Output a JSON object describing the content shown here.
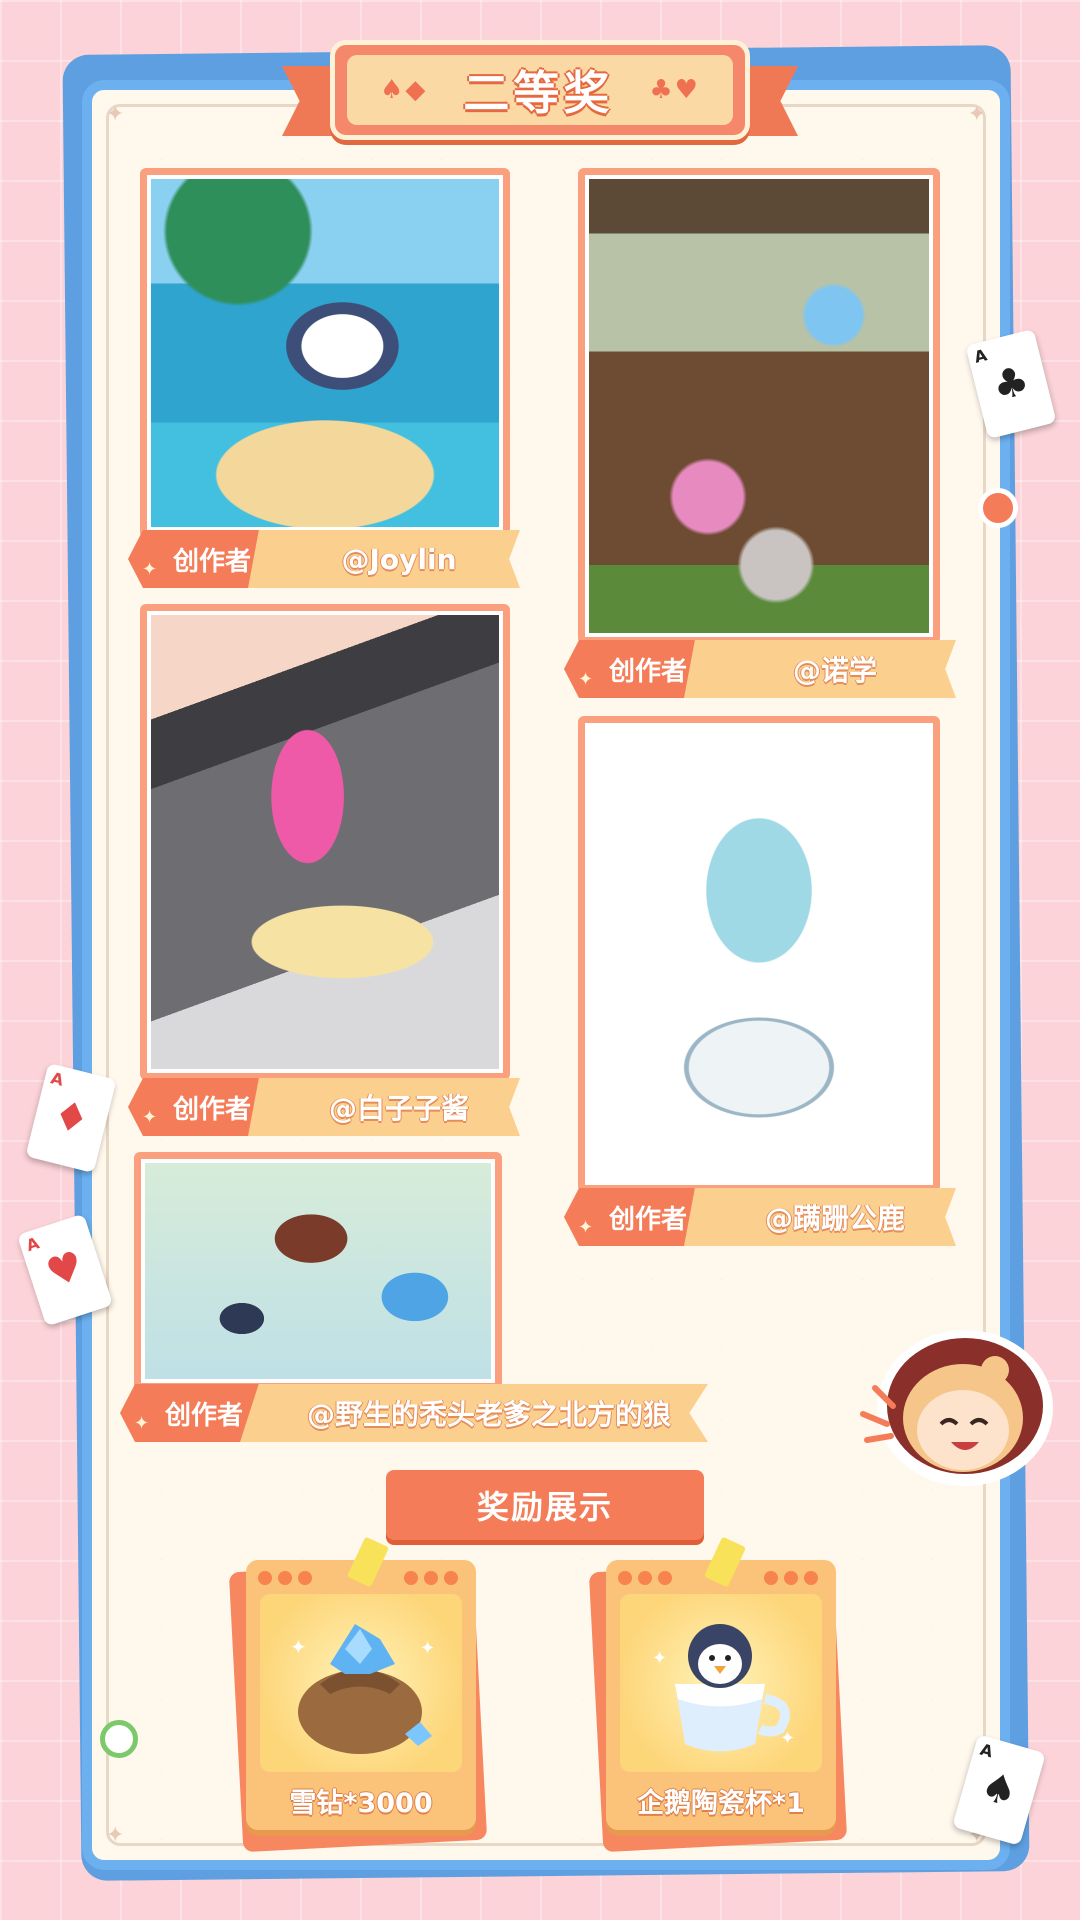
{
  "title": "二等奖",
  "title_suits_left": "♠◆",
  "title_suits_right": "♣♥",
  "author_label": "创作者",
  "artworks": [
    {
      "author": "@Joylin"
    },
    {
      "author": "@诺学"
    },
    {
      "author": "@白子子酱"
    },
    {
      "author": "@蹒跚公鹿"
    },
    {
      "author": "@野生的秃头老爹之北方的狼"
    }
  ],
  "rewards": {
    "heading": "奖励展示",
    "items": [
      {
        "label": "雪钻*3000",
        "icon": "snow-diamond-bag-icon"
      },
      {
        "label": "企鹅陶瓷杯*1",
        "icon": "penguin-cup-icon"
      }
    ]
  },
  "playing_cards": [
    {
      "rank": "A",
      "suit": "♣"
    },
    {
      "rank": "A",
      "suit": "♦"
    },
    {
      "rank": "A",
      "suit": "♥"
    },
    {
      "rank": "A",
      "suit": "♠"
    }
  ],
  "colors": {
    "background": "#fbd3d8",
    "board_border": "#6cb0ef",
    "accent_orange": "#f47c58",
    "ribbon_light": "#fbcf8e"
  }
}
